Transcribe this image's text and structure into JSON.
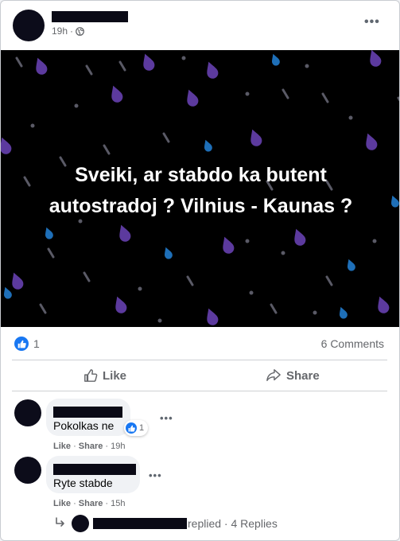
{
  "post": {
    "time": "19h",
    "separator": "·",
    "image_text_line1": "Sveiki, ar stabdo ka butent",
    "image_text_line2": "autostradoj ? Vilnius - Kaunas ?",
    "like_count": "1",
    "comments_count": "6 Comments",
    "like_label": "Like",
    "share_label": "Share",
    "menu_icon": "more-horizontal-icon"
  },
  "colors": {
    "accent": "#1877f2",
    "image_background": "#000000",
    "drop_purple": "#5c3a9e",
    "drop_blue": "#1e6fb8",
    "drop_grey": "#5a5a66"
  },
  "comments": [
    {
      "text": "Pokolkas ne",
      "reaction_count": "1",
      "like": "Like",
      "share": "Share",
      "time": "19h"
    },
    {
      "text": "Ryte stabde",
      "like": "Like",
      "share": "Share",
      "time": "15h"
    }
  ],
  "reply_summary": {
    "text": "replied · 4 Replies"
  }
}
